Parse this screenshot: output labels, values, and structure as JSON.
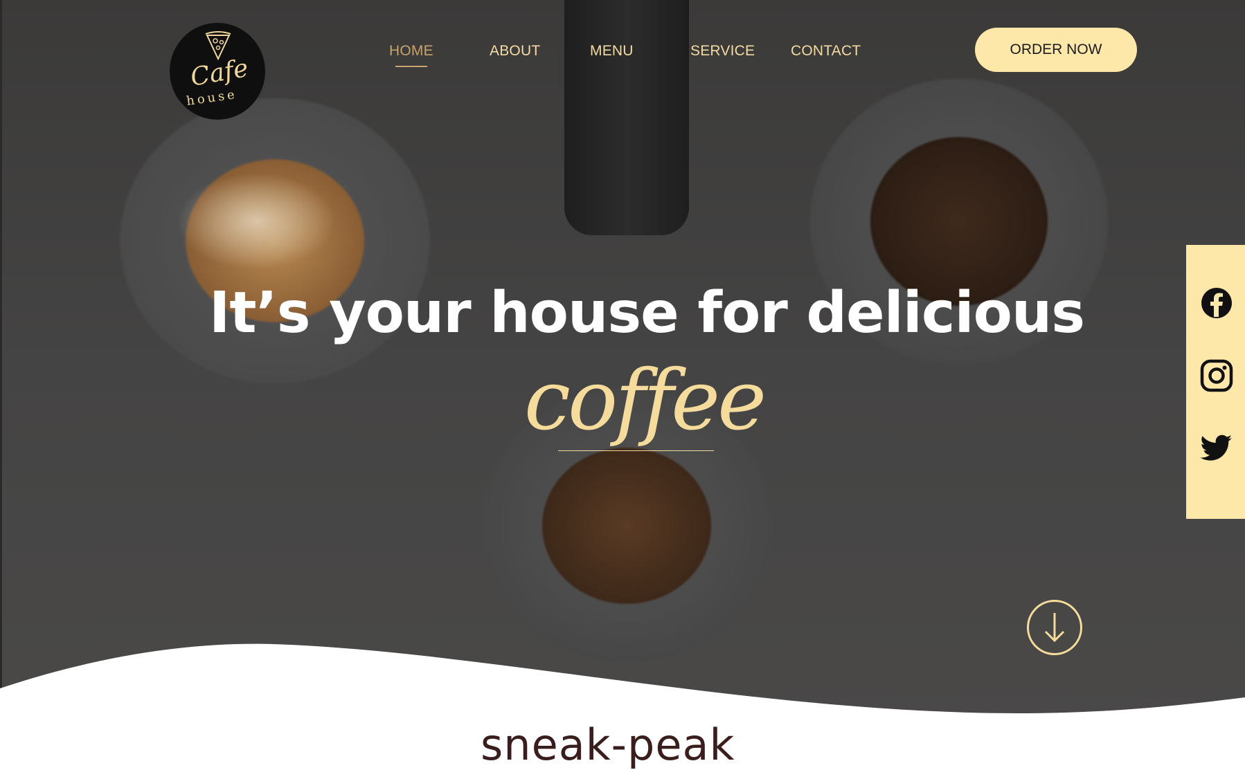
{
  "brand": {
    "logo_icon": "pizza-slice-icon",
    "logo_script": "Cafe",
    "logo_sub": "house"
  },
  "nav": {
    "items": [
      {
        "label": "HOME",
        "active": true
      },
      {
        "label": "ABOUT",
        "active": false
      },
      {
        "label": "MENU",
        "active": false
      },
      {
        "label": "SERVICE",
        "active": false
      },
      {
        "label": "CONTACT",
        "active": false
      }
    ]
  },
  "cta": {
    "order_label": "ORDER NOW"
  },
  "social": {
    "icons": [
      "facebook-icon",
      "instagram-icon",
      "twitter-icon"
    ]
  },
  "hero": {
    "headline": "It’s your house for delicious",
    "script_word": "coffee",
    "scroll_icon": "arrow-down-circle-icon"
  },
  "next_section": {
    "heading": "sneak-peak"
  },
  "colors": {
    "accent": "#fde7a9",
    "accent_text": "#f6dc9c",
    "active_nav": "#c8a36d",
    "overlay": "#3f3e3d",
    "heading_dark": "#3a1e1e"
  }
}
